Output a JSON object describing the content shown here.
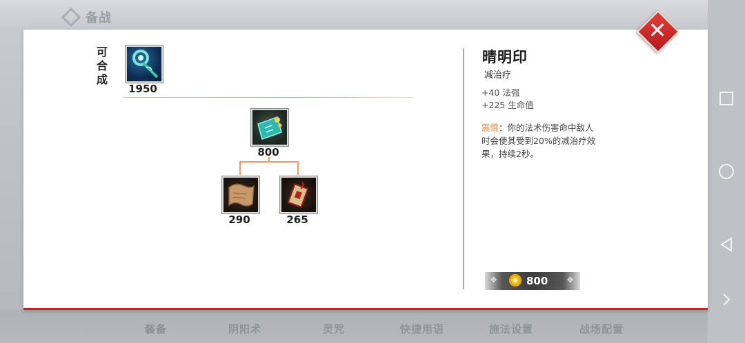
{
  "background": {
    "header_title": "备战",
    "tabs": [
      "装备",
      "阴阳术",
      "灵咒",
      "快捷用语",
      "施法设置",
      "战场配置"
    ]
  },
  "craftable": {
    "label_chars": [
      "可",
      "合",
      "成"
    ],
    "item": {
      "icon": "jade-staff-icon",
      "price": "1950"
    }
  },
  "tree": {
    "root": {
      "icon": "talisman-scroll-icon",
      "price": "800"
    },
    "children": [
      {
        "icon": "parchment-icon",
        "price": "290"
      },
      {
        "icon": "red-charm-icon",
        "price": "265"
      }
    ]
  },
  "detail": {
    "name": "晴明印",
    "tag": "减治疗",
    "stats": [
      "+40 法强",
      "+225 生命值"
    ],
    "passive_name": "震慑",
    "passive_text": "：你的法术伤害命中敌人时会使其受到20%的减治疗效果，持续2秒。",
    "price": "800"
  },
  "colors": {
    "accent_orange": "#e98a44",
    "close_red": "#c4222b",
    "coin_gold": "#f2c21a"
  }
}
